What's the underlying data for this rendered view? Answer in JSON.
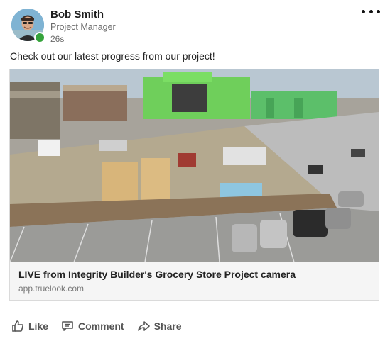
{
  "post": {
    "author_name": "Bob Smith",
    "author_title": "Project Manager",
    "timestamp": "26s",
    "text": "Check out our latest progress from our project!",
    "online_status_color": "#35a33b"
  },
  "link_preview": {
    "title": "LIVE from Integrity Builder's Grocery Store Project camera",
    "domain": "app.truelook.com"
  },
  "actions": {
    "like_label": "Like",
    "comment_label": "Comment",
    "share_label": "Share"
  },
  "icons": {
    "more": "more-horizontal-icon",
    "like": "thumbs-up-icon",
    "comment": "comment-icon",
    "share": "share-arrow-icon"
  }
}
